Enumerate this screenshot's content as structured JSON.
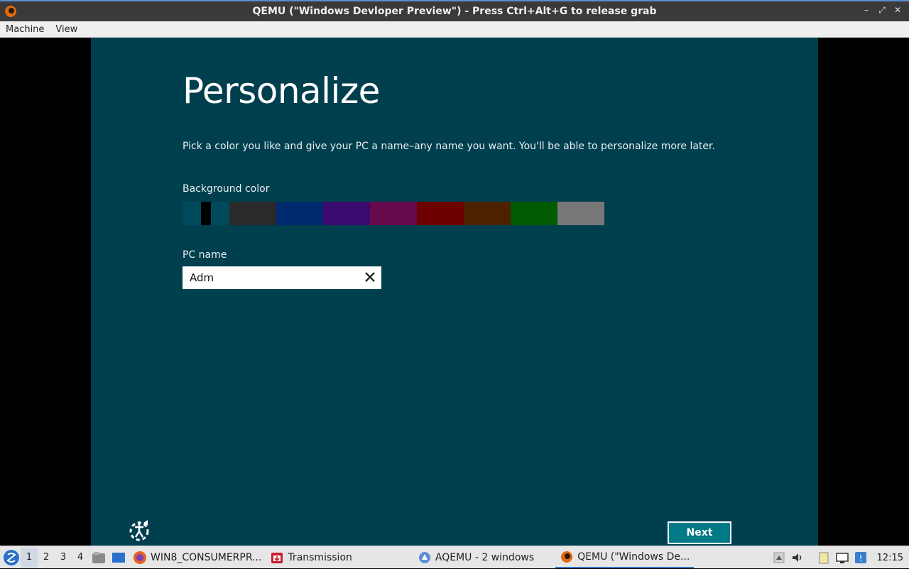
{
  "window": {
    "title": "QEMU (\"Windows Devloper Preview\") - Press Ctrl+Alt+G to release grab"
  },
  "menubar": {
    "items": [
      "Machine",
      "View"
    ]
  },
  "setup": {
    "heading": "Personalize",
    "description": "Pick a color you like and give your PC a name–any name you want. You'll be able to personalize more later.",
    "background_label": "Background color",
    "swatch_colors": [
      "#2a2a2a",
      "#002a6e",
      "#3a0a6e",
      "#660a4c",
      "#6e0000",
      "#4d2000",
      "#005a00",
      "#777777"
    ],
    "slider_color": "#00495a",
    "pc_name_label": "PC name",
    "pc_name_value": "Adm",
    "next_label": "Next"
  },
  "taskbar": {
    "workspaces": [
      "1",
      "2",
      "3",
      "4"
    ],
    "tasks": [
      {
        "label": "WIN8_CONSUMERPR...",
        "icon": "firefox-icon"
      },
      {
        "label": "Transmission",
        "icon": "transmission-icon"
      },
      {
        "label": "AQEMU - 2 windows",
        "icon": "aqemu-icon"
      },
      {
        "label": "QEMU (\"Windows De...",
        "icon": "qemu-icon"
      }
    ],
    "clock": "12:15"
  }
}
